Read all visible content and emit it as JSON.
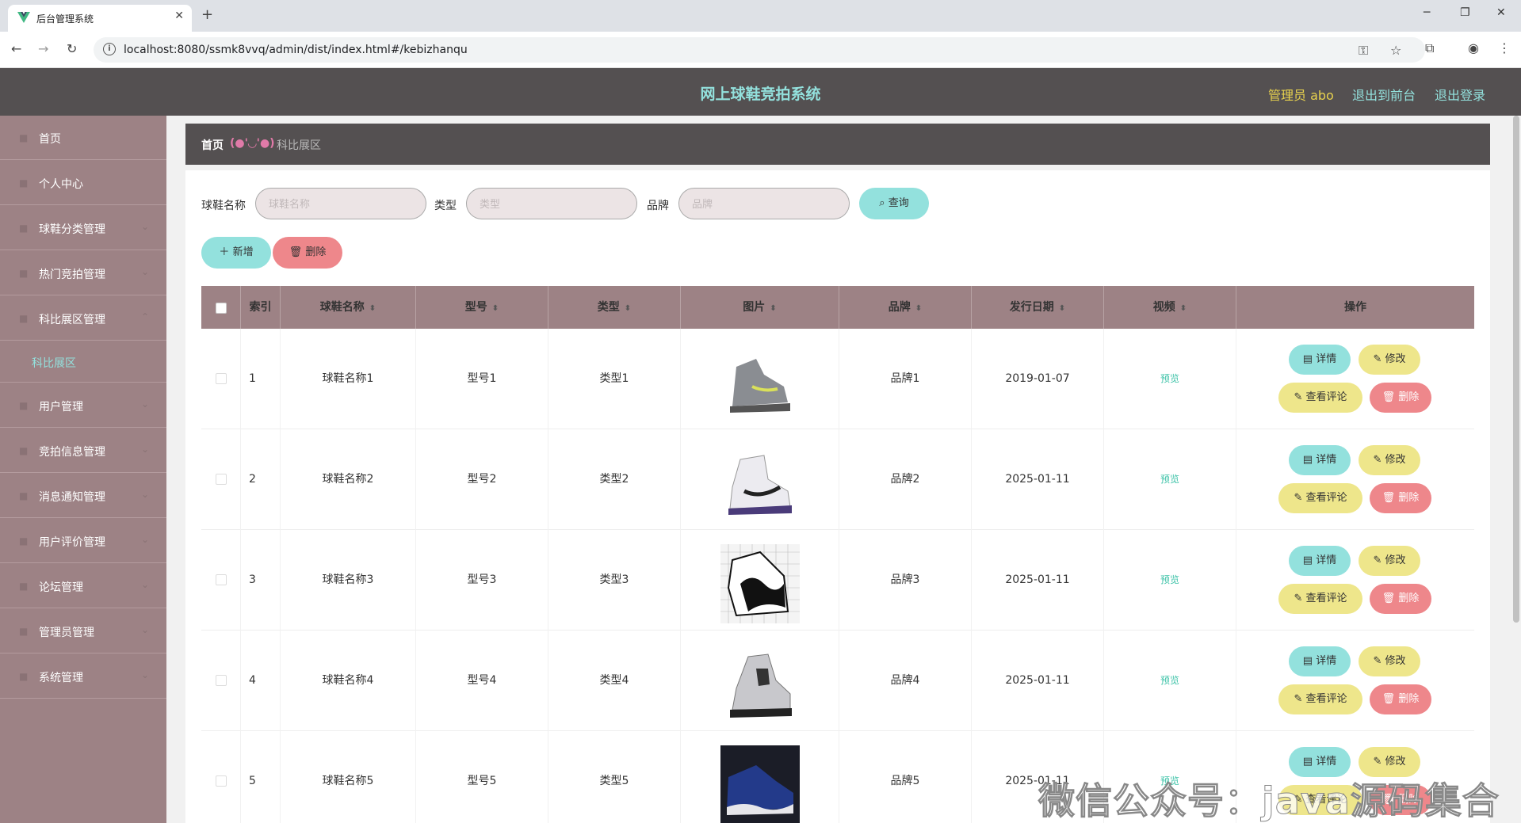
{
  "browser": {
    "tab_title": "后台管理系统",
    "url": "localhost:8080/ssmk8vvq/admin/dist/index.html#/kebizhanqu"
  },
  "header": {
    "title": "网上球鞋竞拍系统",
    "admin": "管理员 abo",
    "to_front": "退出到前台",
    "logout": "退出登录"
  },
  "sidebar": {
    "items": [
      {
        "label": "首页"
      },
      {
        "label": "个人中心"
      },
      {
        "label": "球鞋分类管理"
      },
      {
        "label": "热门竞拍管理"
      },
      {
        "label": "科比展区管理"
      },
      {
        "label": "用户管理"
      },
      {
        "label": "竞拍信息管理"
      },
      {
        "label": "消息通知管理"
      },
      {
        "label": "用户评价管理"
      },
      {
        "label": "论坛管理"
      },
      {
        "label": "管理员管理"
      },
      {
        "label": "系统管理"
      }
    ],
    "submenu_active": "科比展区"
  },
  "breadcrumb": {
    "home": "首页",
    "face": "(●'◡'●)",
    "current": "科比展区"
  },
  "search": {
    "name_label": "球鞋名称",
    "name_placeholder": "球鞋名称",
    "type_label": "类型",
    "type_placeholder": "类型",
    "brand_label": "品牌",
    "brand_placeholder": "品牌",
    "query_button": "查询"
  },
  "actions": {
    "add": "新增",
    "delete": "删除"
  },
  "table": {
    "headers": {
      "index": "索引",
      "name": "球鞋名称",
      "model": "型号",
      "type": "类型",
      "image": "图片",
      "brand": "品牌",
      "date": "发行日期",
      "video": "视频",
      "ops": "操作"
    },
    "rows": [
      {
        "index": "1",
        "name": "球鞋名称1",
        "model": "型号1",
        "type": "类型1",
        "brand": "品牌1",
        "date": "2019-01-07",
        "video": "预览"
      },
      {
        "index": "2",
        "name": "球鞋名称2",
        "model": "型号2",
        "type": "类型2",
        "brand": "品牌2",
        "date": "2025-01-11",
        "video": "预览"
      },
      {
        "index": "3",
        "name": "球鞋名称3",
        "model": "型号3",
        "type": "类型3",
        "brand": "品牌3",
        "date": "2025-01-11",
        "video": "预览"
      },
      {
        "index": "4",
        "name": "球鞋名称4",
        "model": "型号4",
        "type": "类型4",
        "brand": "品牌4",
        "date": "2025-01-11",
        "video": "预览"
      },
      {
        "index": "5",
        "name": "球鞋名称5",
        "model": "型号5",
        "type": "类型5",
        "brand": "品牌5",
        "date": "2025-01-11",
        "video": "预览"
      }
    ],
    "op_labels": {
      "detail": "详情",
      "edit": "修改",
      "comment": "查看评论",
      "delete": "删除"
    }
  },
  "watermark": "微信公众号：java源码集合",
  "colors": {
    "header_bg": "#545051",
    "sidebar_bg": "#9d8285",
    "accent_teal": "#93e1dd",
    "accent_yellow": "#eee68b",
    "accent_red": "#ee878b"
  }
}
